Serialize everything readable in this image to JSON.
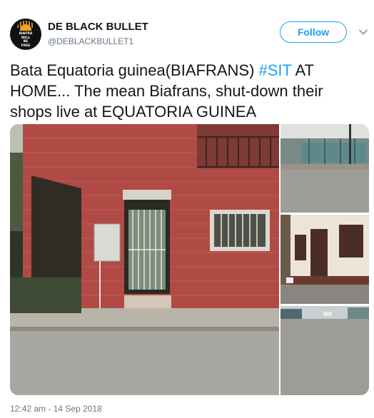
{
  "author": {
    "name": "DE BLACK BULLET",
    "handle": "@DEBLACKBULLET1",
    "avatar_motto": [
      "BIAFRA",
      "WILL",
      "BE",
      "FREE"
    ]
  },
  "follow_label": "Follow",
  "tweet": {
    "text_before": "Bata Equatoria guinea(BIAFRANS) ",
    "hashtag": "#SIT",
    "text_after": " AT HOME... The mean Biafrans, shut-down their shops live at EQUATORIA GUINEA"
  },
  "timestamp": "12:42 am - 14 Sep 2018",
  "colors": {
    "accent": "#1da1f2",
    "secondary_text": "#657786",
    "primary_text": "#14171a"
  },
  "icons": {
    "more": "chevron-down-icon"
  }
}
